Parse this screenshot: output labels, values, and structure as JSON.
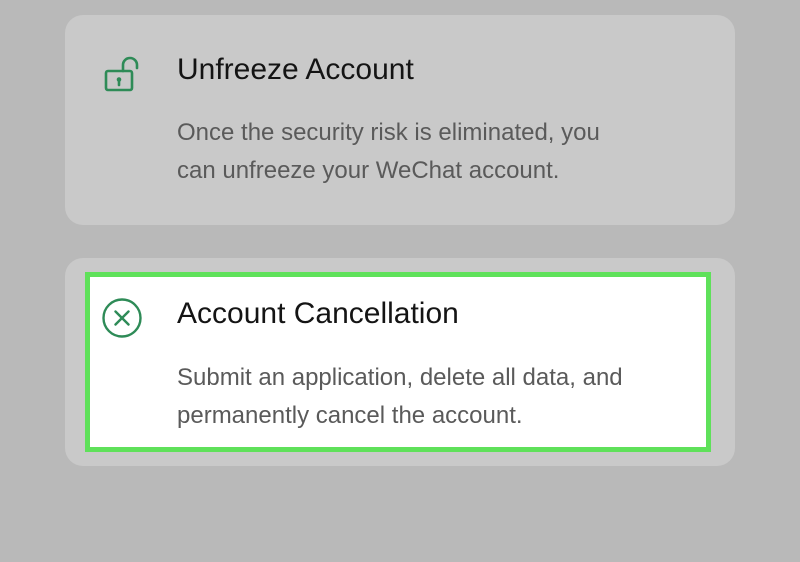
{
  "colors": {
    "background": "#b9b9b9",
    "card": "#c9c9c9",
    "highlight_border": "#5fe15a",
    "icon_green": "#2e8b57"
  },
  "options": [
    {
      "id": "unfreeze",
      "icon": "unlock-icon",
      "title": "Unfreeze Account",
      "description_lines": [
        "Once the security risk is eliminated, you",
        "can unfreeze your WeChat account."
      ],
      "highlighted": false
    },
    {
      "id": "cancellation",
      "icon": "circle-x-icon",
      "title": "Account Cancellation",
      "description_lines": [
        "Submit an application, delete all data, and",
        "permanently cancel the account."
      ],
      "highlighted": true
    }
  ]
}
